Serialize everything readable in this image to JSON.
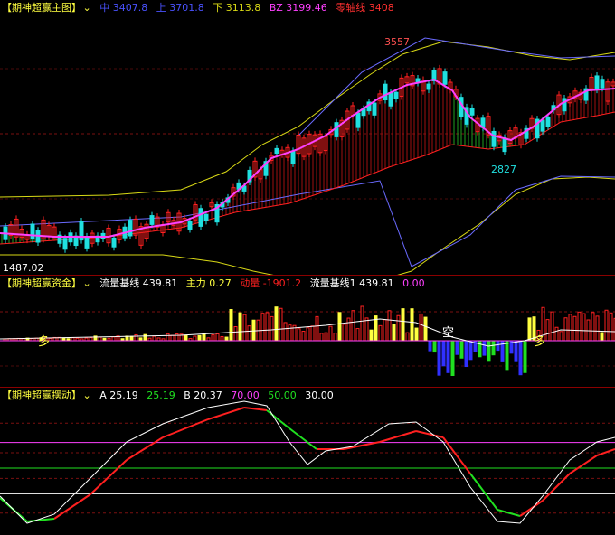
{
  "main": {
    "title": "【期神超赢主图】",
    "indicators": [
      {
        "label": "中 3407.8",
        "color": "#4a52ff"
      },
      {
        "label": "上 3701.8",
        "color": "#4a52ff"
      },
      {
        "label": "下 3113.8",
        "color": "#d9d915"
      },
      {
        "label": "BZ 3199.46",
        "color": "#ff40ff"
      },
      {
        "label": "零轴线 3408",
        "color": "#ff3030"
      }
    ],
    "peak_label": "3557",
    "trough_label": "2827",
    "left_label": "1487.02",
    "colors": {
      "up": "#ff2020",
      "down": "#20e0e0",
      "upper_band": "#d9d915",
      "mid_band": "#6a6aff",
      "bz": "#ff40ff",
      "zero": "#ff3030"
    }
  },
  "fund": {
    "title": "【期神超赢资金】",
    "items": [
      {
        "label": "流量基线 439.81",
        "color": "#ffffff"
      },
      {
        "label": "主力 0.27",
        "color": "#ffff40"
      },
      {
        "label": "动量 -1901.2",
        "color": "#ff2020"
      },
      {
        "label": "流量基线1 439.81",
        "color": "#ffffff"
      },
      {
        "label": "0.00",
        "color": "#ff40ff"
      }
    ],
    "signal_long_1": "多",
    "signal_short": "空",
    "signal_long_2": "多"
  },
  "osc": {
    "title": "【期神超赢摆动】",
    "items": [
      {
        "label": "A 25.19",
        "color": "#ffffff"
      },
      {
        "label": "25.19",
        "color": "#20e020"
      },
      {
        "label": "B 20.37",
        "color": "#ffffff"
      },
      {
        "label": "70.00",
        "color": "#ff40ff"
      },
      {
        "label": "50.00",
        "color": "#20e020"
      },
      {
        "label": "30.00",
        "color": "#ffffff"
      }
    ]
  }
}
